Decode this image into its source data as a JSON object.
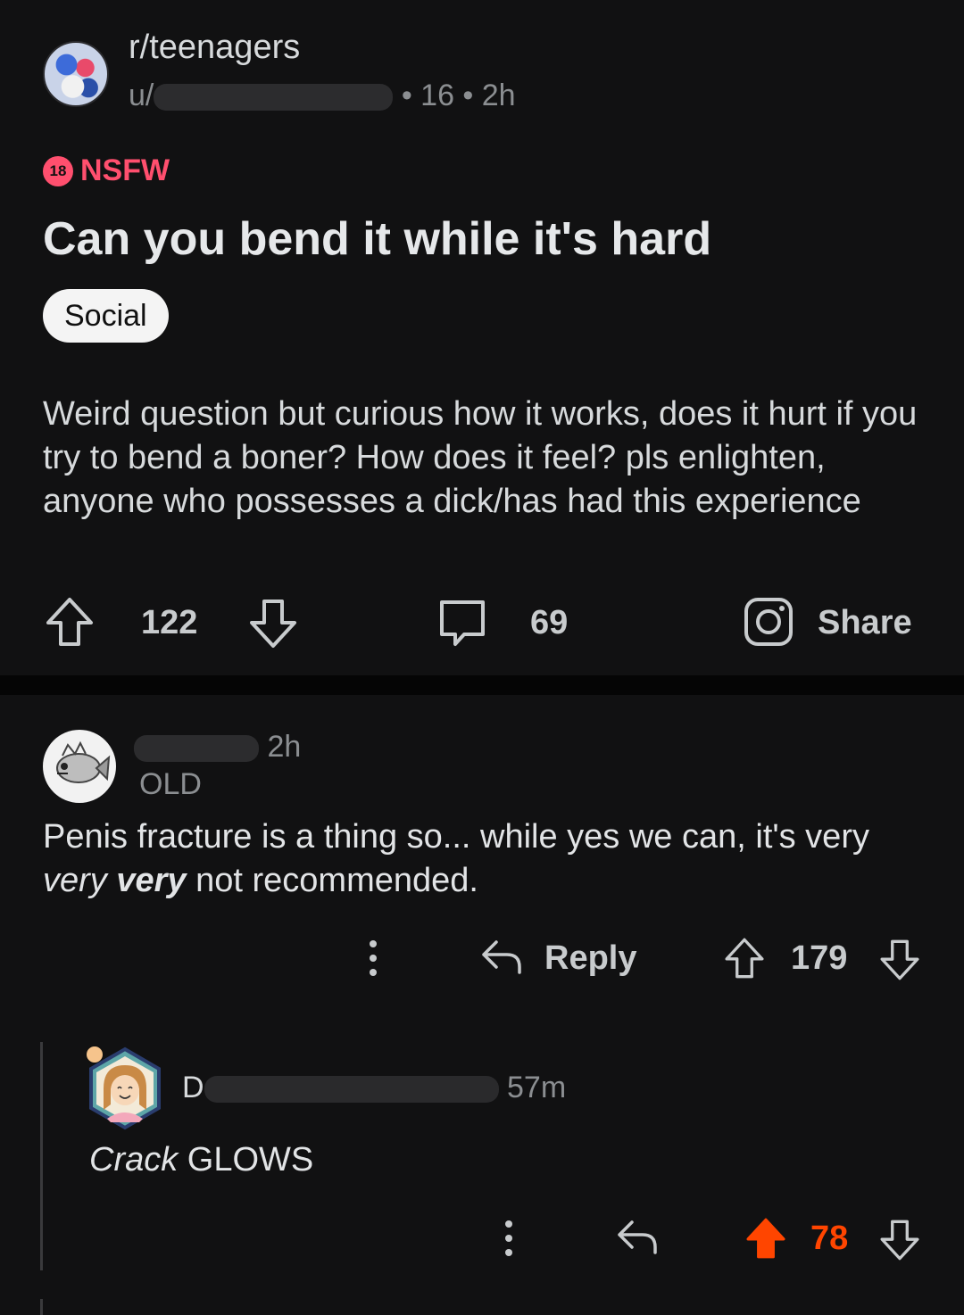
{
  "post": {
    "subreddit": "r/teenagers",
    "author_prefix": "u/",
    "author_suffix": "• 16 • 2h",
    "nsfw_badge": "18",
    "nsfw_label": "NSFW",
    "title": "Can you bend it while it's hard",
    "flair": "Social",
    "body": "Weird question but curious how it works, does it hurt if you try to bend a boner? How does it feel? pls enlighten, anyone who possesses a dick/has had this experience",
    "upvotes": "122",
    "comments": "69",
    "share_label": "Share"
  },
  "comment1": {
    "time": "2h",
    "flair": "OLD",
    "text_part1": "Penis fracture is a thing so... while yes we can, it's very ",
    "text_italic": "very",
    "text_bolditalic": "very",
    "text_part2": " not recommended.",
    "reply_label": "Reply",
    "votes": "179"
  },
  "comment2": {
    "author_initial": "D",
    "time": "57m",
    "text_italic": "Crack",
    "text_rest": " GLOWS",
    "votes": "78",
    "vote_color": "#ff4500"
  },
  "icons": {
    "upvote": "arrow-up-icon",
    "downvote": "arrow-down-icon",
    "comment": "comment-bubble-icon",
    "share": "instagram-icon",
    "reply": "reply-arrow-icon",
    "more": "more-vertical-icon"
  }
}
